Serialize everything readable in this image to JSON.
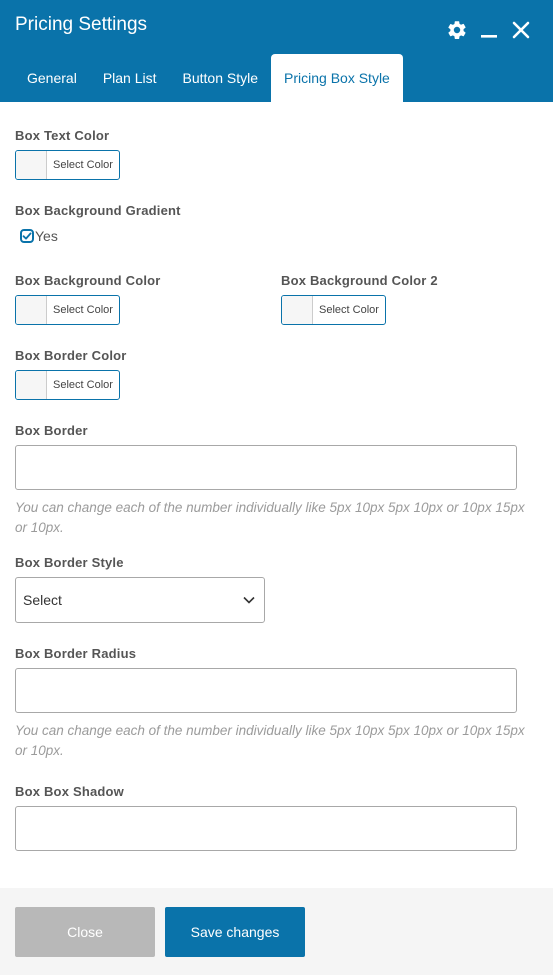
{
  "dialog": {
    "title": "Pricing Settings"
  },
  "tabs": [
    {
      "label": "General"
    },
    {
      "label": "Plan List"
    },
    {
      "label": "Button Style"
    },
    {
      "label": "Pricing Box Style",
      "active": true
    }
  ],
  "fields": {
    "box_text_color": {
      "label": "Box Text Color",
      "button": "Select Color"
    },
    "box_background_gradient": {
      "label": "Box Background Gradient",
      "option": "Yes",
      "checked": true
    },
    "box_background_color": {
      "label": "Box Background Color",
      "button": "Select Color"
    },
    "box_background_color_2": {
      "label": "Box Background Color 2",
      "button": "Select Color"
    },
    "box_border_color": {
      "label": "Box Border Color",
      "button": "Select Color"
    },
    "box_border": {
      "label": "Box Border",
      "value": "",
      "help": "You can change each of the number individually like 5px 10px 5px 10px or 10px 15px or 10px."
    },
    "box_border_style": {
      "label": "Box Border Style",
      "selected": "Select"
    },
    "box_border_radius": {
      "label": "Box Border Radius",
      "value": "",
      "help": "You can change each of the number individually like 5px 10px 5px 10px or 10px 15px or 10px."
    },
    "box_box_shadow": {
      "label": "Box Box Shadow",
      "value": ""
    }
  },
  "footer": {
    "close_label": "Close",
    "save_label": "Save changes"
  },
  "colors": {
    "accent": "#0a73aa",
    "muted_button": "#b8b8b8",
    "footer_bg": "#f5f5f5"
  },
  "icons": {
    "settings": "gear-icon",
    "minimize": "minimize-icon",
    "close": "close-icon",
    "check": "checkmark-icon",
    "dropdown": "chevron-down-icon"
  }
}
